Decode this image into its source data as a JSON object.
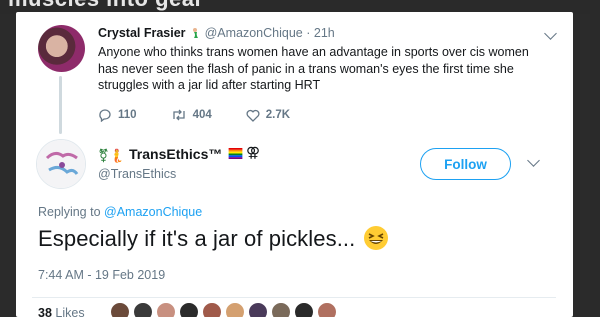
{
  "background_title": "muscles into gear",
  "parent_tweet": {
    "name": "Crystal Frasier",
    "handle": "@AmazonChique",
    "dot": "·",
    "time": "21h",
    "text": "Anyone who thinks trans women have an advantage in sports over cis women has never seen the flash of panic in a trans woman's eyes the first time she struggles with a jar lid after starting HRT",
    "actions": {
      "replies": "110",
      "retweets": "404",
      "likes": "2.7K"
    }
  },
  "main_tweet": {
    "symbols": "⚧🧜",
    "name": "TransEthics™",
    "venus": "⚢",
    "handle": "@TransEthics",
    "follow_label": "Follow",
    "replying_prefix": "Replying to",
    "replying_to": "@AmazonChique",
    "text": "Especially if it's a jar of pickles...",
    "timestamp": "7:44 AM - 19 Feb 2019",
    "likes_count": "38",
    "likes_label": "Likes"
  },
  "colors": {
    "accent": "#1da1f2",
    "text": "#14171a",
    "muted": "#657786",
    "dark_bg": "#2b2b2b"
  },
  "liker_colors": [
    "#6b4a3a",
    "#3a3a3a",
    "#c89080",
    "#2b2b2b",
    "#a05a4a",
    "#d4a070",
    "#4a3a5a",
    "#7a6a5a",
    "#2a2a2a",
    "#b07060"
  ]
}
